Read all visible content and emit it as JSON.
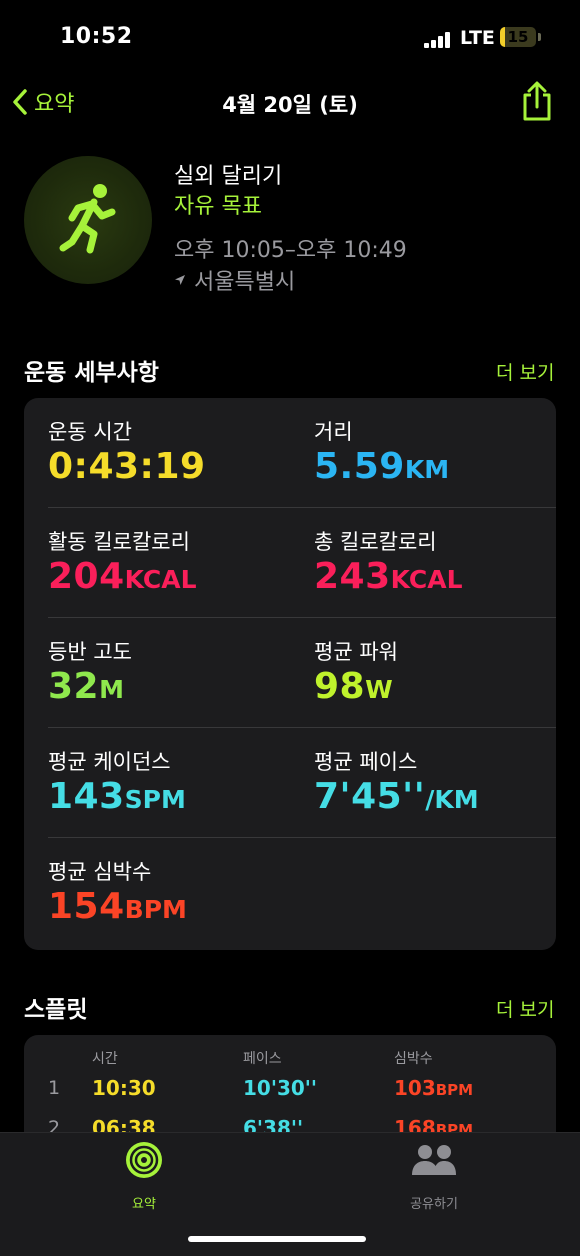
{
  "status_bar": {
    "time": "10:52",
    "network": "LTE",
    "battery": "15",
    "battery_level": 0.15
  },
  "nav": {
    "back_label": "요약",
    "title": "4월 20일 (토)"
  },
  "workout": {
    "title": "실외 달리기",
    "goal": "자유 목표",
    "time_range": "오후 10:05–오후 10:49",
    "location": "서울특별시"
  },
  "details": {
    "title": "운동 세부사항",
    "more": "더 보기",
    "metrics": [
      {
        "label": "운동 시간",
        "value": "0:43:19",
        "unit": "",
        "color": "#f5dc2a"
      },
      {
        "label": "거리",
        "value": "5.59",
        "unit": "KM",
        "color": "#2bb5f3"
      },
      {
        "label": "활동 킬로칼로리",
        "value": "204",
        "unit": "KCAL",
        "color": "#fa1f5a"
      },
      {
        "label": "총 킬로칼로리",
        "value": "243",
        "unit": "KCAL",
        "color": "#fa1f5a"
      },
      {
        "label": "등반 고도",
        "value": "32",
        "unit": "M",
        "color": "#8fe84d"
      },
      {
        "label": "평균 파워",
        "value": "98",
        "unit": "W",
        "color": "#bff22c"
      },
      {
        "label": "평균 케이던스",
        "value": "143",
        "unit": "SPM",
        "color": "#45dde5"
      },
      {
        "label": "평균 페이스",
        "value": "7'45''",
        "unit": "/KM",
        "color": "#45dde5"
      },
      {
        "label": "평균 심박수",
        "value": "154",
        "unit": "BPM",
        "color": "#fb4426"
      }
    ]
  },
  "splits": {
    "title": "스플릿",
    "more": "더 보기",
    "headers": [
      "시간",
      "페이스",
      "심박수"
    ],
    "rows": [
      {
        "idx": "1",
        "time": "10:30",
        "pace": "10'30''",
        "hr": "103",
        "hr_unit": "BPM"
      },
      {
        "idx": "2",
        "time": "06:38",
        "pace": "6'38''",
        "hr": "168",
        "hr_unit": "BPM"
      }
    ],
    "colors": {
      "time": "#f5dc2a",
      "pace": "#45dde5",
      "hr": "#fb4426"
    }
  },
  "tabbar": {
    "tabs": [
      {
        "label": "요약",
        "active": true
      },
      {
        "label": "공유하기",
        "active": false
      }
    ]
  },
  "colors": {
    "accent": "#a6f23a",
    "background": "#000000",
    "card": "#1c1c1e"
  },
  "icons": [
    "chevron-left-icon",
    "share-icon",
    "running-figure-icon",
    "location-arrow-icon",
    "activity-rings-icon",
    "people-icon"
  ]
}
